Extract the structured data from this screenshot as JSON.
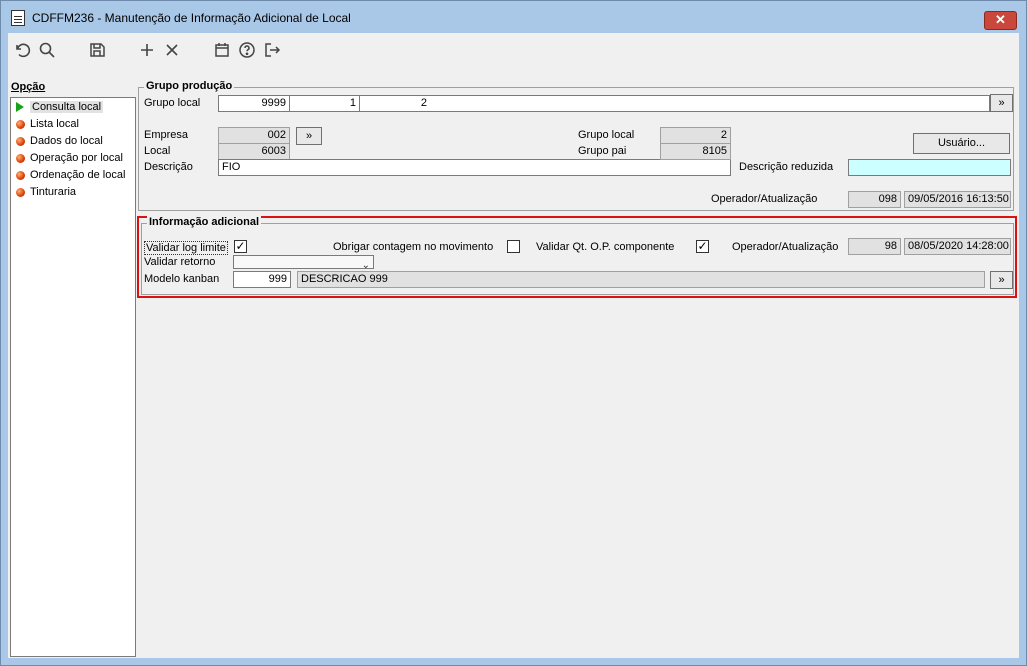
{
  "window": {
    "title": "CDFFM236 - Manutenção de Informação Adicional de Local",
    "close_label": "✕"
  },
  "toolbar": {
    "icons": [
      "undo-icon",
      "search-icon",
      "save-icon",
      "add-icon",
      "delete-icon",
      "calendar-icon",
      "help-icon",
      "exit-icon"
    ]
  },
  "sidebar": {
    "title": "Opção",
    "items": [
      {
        "label": "Consulta local",
        "selected": true
      },
      {
        "label": "Lista local"
      },
      {
        "label": "Dados do local"
      },
      {
        "label": "Operação por local"
      },
      {
        "label": "Ordenação de local"
      },
      {
        "label": "Tinturaria"
      }
    ]
  },
  "grupo_producao": {
    "legend": "Grupo produção",
    "grupo_local_label": "Grupo local",
    "grupo_local_values": [
      "9999",
      "1",
      "2"
    ],
    "nav_button": "»",
    "empresa_label": "Empresa",
    "empresa_value": "002",
    "local_label": "Local",
    "local_value": "6003",
    "descricao_label": "Descrição",
    "descricao_value": "FIO",
    "grupo_local2_label": "Grupo local",
    "grupo_local2_value": "2",
    "grupo_pai_label": "Grupo pai",
    "grupo_pai_value": "8105",
    "usuario_button": "Usuário...",
    "descricao_reduzida_label": "Descrição reduzida",
    "descricao_reduzida_value": "",
    "operador_label": "Operador/Atualização",
    "operador_value": "098",
    "atualizacao_value": "09/05/2016 16:13:50"
  },
  "info_adicional": {
    "legend": "Informação adicional",
    "validar_log_label": "Validar log limite",
    "validar_log_checked": "✓",
    "obrigar_label": "Obrigar contagem no movimento",
    "obrigar_checked": "",
    "validar_qt_label": "Validar Qt. O.P. componente",
    "validar_qt_checked": "✓",
    "operador_label": "Operador/Atualização",
    "operador_value": "98",
    "atualizacao_value": "08/05/2020 14:28:00",
    "validar_retorno_label": "Validar retorno",
    "validar_retorno_value": "",
    "modelo_kanban_label": "Modelo kanban",
    "modelo_kanban_value": "999",
    "modelo_kanban_desc": "DESCRICAO 999",
    "nav_button": "»"
  }
}
